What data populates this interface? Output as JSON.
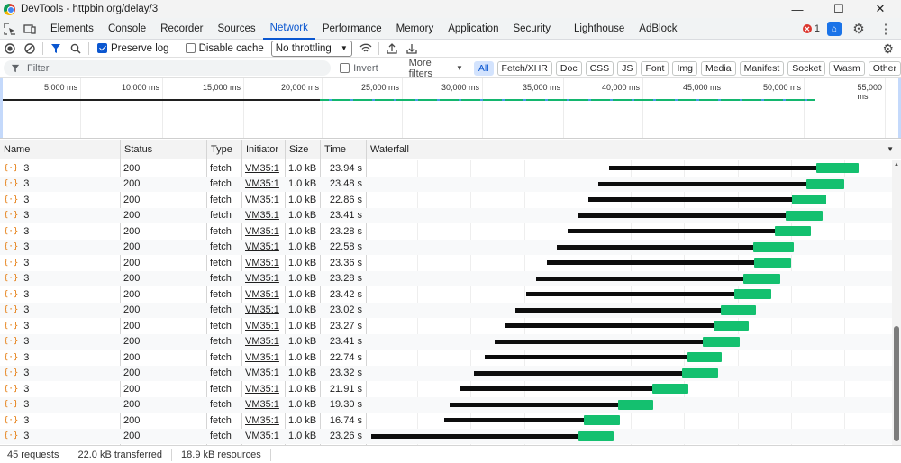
{
  "window": {
    "title": "DevTools - httpbin.org/delay/3",
    "minimize": "—",
    "maximize": "☐",
    "close": "✕"
  },
  "tabs": [
    {
      "label": "Elements",
      "name": "tab-elements",
      "active": false
    },
    {
      "label": "Console",
      "name": "tab-console",
      "active": false
    },
    {
      "label": "Recorder",
      "name": "tab-recorder",
      "active": false
    },
    {
      "label": "Sources",
      "name": "tab-sources",
      "active": false
    },
    {
      "label": "Network",
      "name": "tab-network",
      "active": true
    },
    {
      "label": "Performance",
      "name": "tab-performance",
      "active": false
    },
    {
      "label": "Memory",
      "name": "tab-memory",
      "active": false
    },
    {
      "label": "Application",
      "name": "tab-application",
      "active": false
    },
    {
      "label": "Security",
      "name": "tab-security",
      "active": false
    },
    {
      "label": "Lighthouse",
      "name": "tab-lighthouse",
      "active": false
    },
    {
      "label": "AdBlock",
      "name": "tab-adblock",
      "active": false
    }
  ],
  "errors": {
    "count": "1"
  },
  "toolbar": {
    "preserve_log": "Preserve log",
    "preserve_log_checked": true,
    "disable_cache": "Disable cache",
    "disable_cache_checked": false,
    "throttling": "No throttling"
  },
  "filter": {
    "placeholder": "Filter",
    "invert": "Invert",
    "more_filters": "More filters",
    "chips": [
      "All",
      "Fetch/XHR",
      "Doc",
      "CSS",
      "JS",
      "Font",
      "Img",
      "Media",
      "Manifest",
      "Socket",
      "Wasm",
      "Other"
    ],
    "active_chip": "All"
  },
  "overview": {
    "ticks": [
      "5,000 ms",
      "10,000 ms",
      "15,000 ms",
      "20,000 ms",
      "25,000 ms",
      "30,000 ms",
      "35,000 ms",
      "40,000 ms",
      "45,000 ms",
      "50,000 ms",
      "55,000 ms"
    ]
  },
  "columns": [
    "Name",
    "Status",
    "Type",
    "Initiator",
    "Size",
    "Time",
    "Waterfall"
  ],
  "rows": [
    {
      "name": "3",
      "status": "200",
      "type": "fetch",
      "initiator": "VM35:1",
      "size": "1.0 kB",
      "time": "23.94 s",
      "wait": [
        676,
        906
      ],
      "dl": [
        906,
        953
      ]
    },
    {
      "name": "3",
      "status": "200",
      "type": "fetch",
      "initiator": "VM35:1",
      "size": "1.0 kB",
      "time": "23.48 s",
      "wait": [
        664,
        895
      ],
      "dl": [
        895,
        937
      ]
    },
    {
      "name": "3",
      "status": "200",
      "type": "fetch",
      "initiator": "VM35:1",
      "size": "1.0 kB",
      "time": "22.86 s",
      "wait": [
        653,
        879
      ],
      "dl": [
        879,
        917
      ]
    },
    {
      "name": "3",
      "status": "200",
      "type": "fetch",
      "initiator": "VM35:1",
      "size": "1.0 kB",
      "time": "23.41 s",
      "wait": [
        641,
        872
      ],
      "dl": [
        872,
        913
      ]
    },
    {
      "name": "3",
      "status": "200",
      "type": "fetch",
      "initiator": "VM35:1",
      "size": "1.0 kB",
      "time": "23.28 s",
      "wait": [
        630,
        860
      ],
      "dl": [
        860,
        900
      ]
    },
    {
      "name": "3",
      "status": "200",
      "type": "fetch",
      "initiator": "VM35:1",
      "size": "1.0 kB",
      "time": "22.58 s",
      "wait": [
        618,
        836
      ],
      "dl": [
        836,
        881
      ]
    },
    {
      "name": "3",
      "status": "200",
      "type": "fetch",
      "initiator": "VM35:1",
      "size": "1.0 kB",
      "time": "23.36 s",
      "wait": [
        607,
        837
      ],
      "dl": [
        837,
        878
      ]
    },
    {
      "name": "3",
      "status": "200",
      "type": "fetch",
      "initiator": "VM35:1",
      "size": "1.0 kB",
      "time": "23.28 s",
      "wait": [
        595,
        825
      ],
      "dl": [
        825,
        866
      ]
    },
    {
      "name": "3",
      "status": "200",
      "type": "fetch",
      "initiator": "VM35:1",
      "size": "1.0 kB",
      "time": "23.42 s",
      "wait": [
        584,
        815
      ],
      "dl": [
        815,
        856
      ]
    },
    {
      "name": "3",
      "status": "200",
      "type": "fetch",
      "initiator": "VM35:1",
      "size": "1.0 kB",
      "time": "23.02 s",
      "wait": [
        572,
        800
      ],
      "dl": [
        800,
        839
      ]
    },
    {
      "name": "3",
      "status": "200",
      "type": "fetch",
      "initiator": "VM35:1",
      "size": "1.0 kB",
      "time": "23.27 s",
      "wait": [
        561,
        792
      ],
      "dl": [
        792,
        831
      ]
    },
    {
      "name": "3",
      "status": "200",
      "type": "fetch",
      "initiator": "VM35:1",
      "size": "1.0 kB",
      "time": "23.41 s",
      "wait": [
        549,
        780
      ],
      "dl": [
        780,
        821
      ]
    },
    {
      "name": "3",
      "status": "200",
      "type": "fetch",
      "initiator": "VM35:1",
      "size": "1.0 kB",
      "time": "22.74 s",
      "wait": [
        538,
        763
      ],
      "dl": [
        763,
        801
      ]
    },
    {
      "name": "3",
      "status": "200",
      "type": "fetch",
      "initiator": "VM35:1",
      "size": "1.0 kB",
      "time": "23.32 s",
      "wait": [
        526,
        757
      ],
      "dl": [
        757,
        797
      ]
    },
    {
      "name": "3",
      "status": "200",
      "type": "fetch",
      "initiator": "VM35:1",
      "size": "1.0 kB",
      "time": "21.91 s",
      "wait": [
        510,
        724
      ],
      "dl": [
        724,
        764
      ]
    },
    {
      "name": "3",
      "status": "200",
      "type": "fetch",
      "initiator": "VM35:1",
      "size": "1.0 kB",
      "time": "19.30 s",
      "wait": [
        499,
        686
      ],
      "dl": [
        686,
        725
      ]
    },
    {
      "name": "3",
      "status": "200",
      "type": "fetch",
      "initiator": "VM35:1",
      "size": "1.0 kB",
      "time": "16.74 s",
      "wait": [
        493,
        648
      ],
      "dl": [
        648,
        688
      ]
    },
    {
      "name": "3",
      "status": "200",
      "type": "fetch",
      "initiator": "VM35:1",
      "size": "1.0 kB",
      "time": "23.26 s",
      "wait": [
        412,
        642
      ],
      "dl": [
        642,
        681
      ]
    }
  ],
  "status": {
    "requests": "45 requests",
    "transferred": "22.0 kB transferred",
    "resources": "18.9 kB resources"
  }
}
